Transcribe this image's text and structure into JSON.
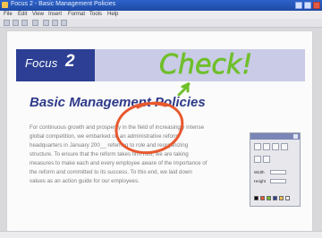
{
  "window": {
    "title": "Focus 2 - Basic Management Policies",
    "controls": [
      "minimize",
      "maximize",
      "close"
    ]
  },
  "menubar": {
    "items": [
      "File",
      "Edit",
      "View",
      "Insert",
      "Format",
      "Tools",
      "Help"
    ]
  },
  "toolbar": {
    "icons": [
      "new-icon",
      "open-icon",
      "save-icon",
      "print-icon",
      "cut-icon",
      "copy-icon",
      "paste-icon"
    ]
  },
  "document": {
    "focus_label": "Focus",
    "focus_number": "2",
    "heading": "Basic Management Policies",
    "body_lines": [
      "For continuous growth and prosperity in the field of increasingly intense",
      "global competition, we embarked on an administrative reform",
      "headquarters in January 200__ referring to role and reorganizing",
      "structure. To ensure that the reform takes firm root, we are taking",
      "measures to make each and every employee aware of the importance of",
      "the reform and committed to its success. To this end, we laid down",
      "values as an action guide for our employees."
    ]
  },
  "annotation": {
    "handwritten_text": "Check!",
    "ink_color": "#6fbf2a",
    "circle_color": "#e8582e"
  },
  "palette": {
    "width_label": "Width",
    "height_label": "Height",
    "width_value": "",
    "height_value": "",
    "colors": [
      "#000000",
      "#e8582e",
      "#6fbf2a",
      "#2d3f94",
      "#f2c14e",
      "#ffffff"
    ]
  },
  "status": {
    "text": ""
  }
}
